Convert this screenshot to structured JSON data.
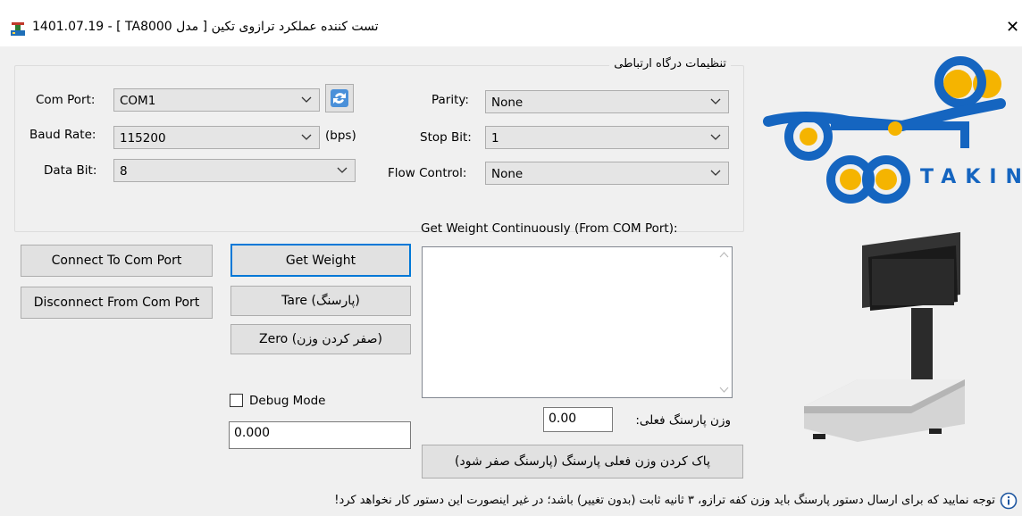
{
  "window": {
    "title": "1401.07.19 - [ TA8000 مدل ] تست کننده عملکرد ترازوی تکین",
    "app_icon": "scale-icon",
    "close_icon": "close-icon"
  },
  "port_settings": {
    "legend": "تنظیمات درگاه ارتباطی",
    "com_port_label": "Com Port:",
    "com_port_value": "COM1",
    "baud_rate_label": "Baud Rate:",
    "baud_rate_value": "115200",
    "baud_unit": "(bps)",
    "data_bit_label": "Data Bit:",
    "data_bit_value": "8",
    "parity_label": "Parity:",
    "parity_value": "None",
    "stop_bit_label": "Stop Bit:",
    "stop_bit_value": "1",
    "flow_control_label": "Flow Control:",
    "flow_control_value": "None",
    "refresh_icon": "refresh-icon"
  },
  "buttons": {
    "connect": "Connect To Com Port",
    "disconnect": "Disconnect From Com Port",
    "get_weight": "Get Weight",
    "tare": "Tare (پارسنگ)",
    "zero": "Zero (صفر کردن وزن)",
    "clear_tare": "پاک کردن وزن فعلی پارسنگ (پارسنگ صفر شود)"
  },
  "debug": {
    "label": "Debug Mode",
    "checked": false,
    "value": "0.000"
  },
  "continuous": {
    "label": "Get Weight Continuously (From COM Port):",
    "content": ""
  },
  "tare_current": {
    "label": "وزن پارسنگ فعلی:",
    "value": "0.00"
  },
  "logo": {
    "text": "TAKIN"
  },
  "note": {
    "text": "توجه نمایید که برای ارسال دستور پارسنگ باید وزن کفه ترازو، ۳ ثانیه ثابت (بدون تغییر) باشد؛ در غیر اینصورت این دستور کار نخواهد کرد!",
    "icon": "info-icon"
  },
  "colors": {
    "accent": "#0078d7",
    "logo_blue": "#1565c0",
    "logo_gold": "#f5b400",
    "window_bg": "#f0f0f0"
  }
}
